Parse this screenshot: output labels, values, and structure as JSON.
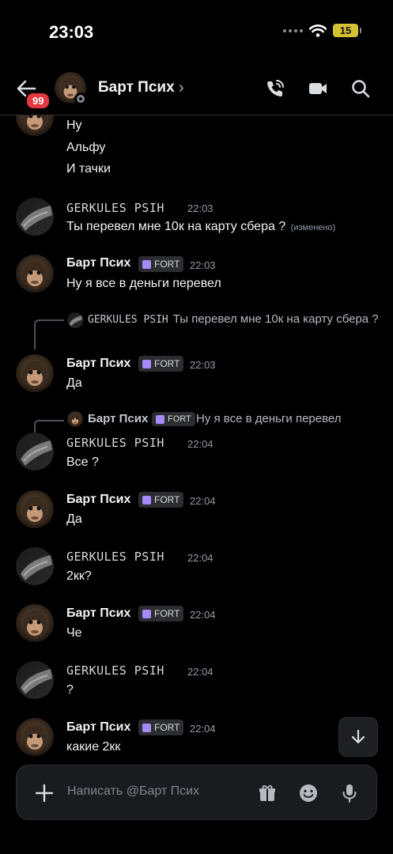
{
  "status_bar": {
    "time": "23:03",
    "battery": "15"
  },
  "header": {
    "name": "Барт Псих",
    "unread_count": "99"
  },
  "messages": [
    {
      "kind": "continuation",
      "lines": [
        "Ну",
        "Альфу",
        "И тачки"
      ]
    },
    {
      "author": "GERKULES PSIH",
      "time": "22:03",
      "text": "Ты перевел мне 10к на карту сбера ?",
      "edited": "(изменено)"
    },
    {
      "author": "Барт Псих",
      "tag": "FORT",
      "time": "22:03",
      "text": "Ну я все в деньги перевел"
    },
    {
      "reply_author": "GERKULES PSIH",
      "reply_text_1": "Ты перевел мне 10к на карту",
      "reply_text_2": "сбера ?",
      "author": "Барт Псих",
      "tag": "FORT",
      "time": "22:03",
      "text": "Да"
    },
    {
      "reply_author": "Барт Псих",
      "reply_tag": "FORT",
      "reply_text": "Ну я все в деньги перевел",
      "author": "GERKULES PSIH",
      "time": "22:04",
      "text": "Все ?"
    },
    {
      "author": "Барт Псих",
      "tag": "FORT",
      "time": "22:04",
      "text": "Да"
    },
    {
      "author": "GERKULES PSIH",
      "time": "22:04",
      "text": "2кк?"
    },
    {
      "author": "Барт Псих",
      "tag": "FORT",
      "time": "22:04",
      "text": "Че"
    },
    {
      "author": "GERKULES PSIH",
      "time": "22:04",
      "text": "?"
    },
    {
      "author": "Барт Псих",
      "tag": "FORT",
      "time": "22:04",
      "text": "какие 2кк"
    }
  ],
  "composer": {
    "placeholder": "Написать @Барт Псих"
  },
  "icons": [
    "back-arrow-icon",
    "phone-call-icon",
    "video-camera-icon",
    "search-icon",
    "chevron-right-icon",
    "arrow-down-icon",
    "plus-icon",
    "gift-icon",
    "emoji-icon",
    "microphone-icon",
    "wifi-icon"
  ],
  "colors": {
    "background": "#000000",
    "badge": "#e2383f",
    "muted": "#949ba4",
    "tag_icon": "#a78bfa"
  }
}
